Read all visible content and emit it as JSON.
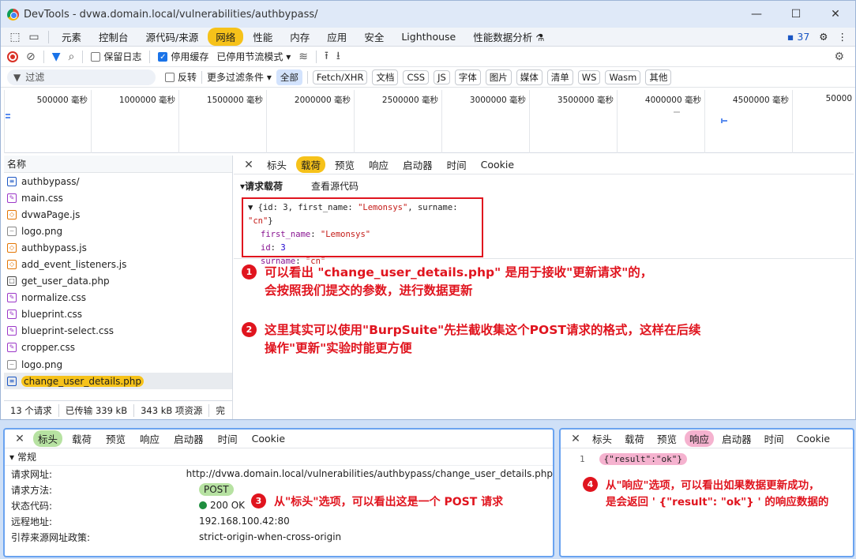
{
  "window": {
    "title": "DevTools - dvwa.domain.local/vulnerabilities/authbypass/",
    "controls": [
      "—",
      "☐",
      "✕"
    ]
  },
  "main_tabs": {
    "items": [
      "元素",
      "控制台",
      "源代码/来源",
      "网络",
      "性能",
      "内存",
      "应用",
      "安全",
      "Lighthouse",
      "性能数据分析 ⚗"
    ],
    "active": "网络",
    "message_count": "37"
  },
  "toolbar": {
    "preserve_log": "保留日志",
    "disable_cache": "停用缓存",
    "throttling": "已停用节流模式"
  },
  "filterbar": {
    "filter_placeholder": "过滤",
    "invert": "反转",
    "more_filters": "更多过滤条件 ▾",
    "types": [
      "全部",
      "Fetch/XHR",
      "文档",
      "CSS",
      "JS",
      "字体",
      "图片",
      "媒体",
      "清单",
      "WS",
      "Wasm",
      "其他"
    ],
    "active_type": "全部"
  },
  "timeline": {
    "ticks": [
      "500000 毫秒",
      "1000000 毫秒",
      "1500000 毫秒",
      "2000000 毫秒",
      "2500000 毫秒",
      "3000000 毫秒",
      "3500000 毫秒",
      "4000000 毫秒",
      "4500000 毫秒",
      "50000"
    ]
  },
  "request_list": {
    "header": "名称",
    "items": [
      {
        "name": "authbypass/",
        "type": "doc"
      },
      {
        "name": "main.css",
        "type": "css"
      },
      {
        "name": "dvwaPage.js",
        "type": "js"
      },
      {
        "name": "logo.png",
        "type": "img"
      },
      {
        "name": "authbypass.js",
        "type": "js"
      },
      {
        "name": "add_event_listeners.js",
        "type": "js"
      },
      {
        "name": "get_user_data.php",
        "type": "php"
      },
      {
        "name": "normalize.css",
        "type": "css"
      },
      {
        "name": "blueprint.css",
        "type": "css"
      },
      {
        "name": "blueprint-select.css",
        "type": "css"
      },
      {
        "name": "cropper.css",
        "type": "css"
      },
      {
        "name": "logo.png",
        "type": "img"
      },
      {
        "name": "change_user_details.php",
        "type": "doc"
      }
    ],
    "selected_index": 12,
    "status": [
      "13 个请求",
      "已传输 339 kB",
      "343 kB 项资源",
      "完"
    ]
  },
  "detail": {
    "tabs": [
      "标头",
      "载荷",
      "预览",
      "响应",
      "启动器",
      "时间",
      "Cookie"
    ],
    "active": "载荷",
    "payload_title": "▾请求载荷",
    "view_source": "查看源代码",
    "payload_summary_open": "▼ {id: 3, first_name: ",
    "payload_summary_fn": "\"Lemonsys\"",
    "payload_summary_mid": ", surname: ",
    "payload_summary_sn": "\"cn\"",
    "payload_summary_close": "}",
    "fields": [
      {
        "key": "first_name",
        "value": "\"Lemonsys\"",
        "kind": "string"
      },
      {
        "key": "id",
        "value": "3",
        "kind": "number"
      },
      {
        "key": "surname",
        "value": "\"cn\"",
        "kind": "string"
      }
    ]
  },
  "annotations": {
    "n1": {
      "num": "1",
      "line1": "可以看出 \"change_user_details.php\" 是用于接收\"更新请求\"的，",
      "line2": "会按照我们提交的参数，进行数据更新"
    },
    "n2": {
      "num": "2",
      "line1": "这里其实可以使用\"BurpSuite\"先拦截收集这个POST请求的格式，这样在后续",
      "line2": "操作\"更新\"实验时能更方便"
    },
    "n3": {
      "num": "3",
      "line1": "从\"标头\"选项，可以看出这是一个 POST 请求"
    },
    "n4": {
      "num": "4",
      "line1": "从\"响应\"选项，可以看出如果数据更新成功，",
      "line2": "是会返回 ' {\"result\": \"ok\"} ' 的响应数据的"
    }
  },
  "headers_panel": {
    "tabs": [
      "标头",
      "载荷",
      "预览",
      "响应",
      "启动器",
      "时间",
      "Cookie"
    ],
    "active": "标头",
    "section": "常规",
    "rows": [
      {
        "label": "请求网址:",
        "value": "http://dvwa.domain.local/vulnerabilities/authbypass/change_user_details.php"
      },
      {
        "label": "请求方法:",
        "value": "POST"
      },
      {
        "label": "状态代码:",
        "value": "200 OK"
      },
      {
        "label": "远程地址:",
        "value": "192.168.100.42:80"
      },
      {
        "label": "引荐来源网址政策:",
        "value": "strict-origin-when-cross-origin"
      }
    ]
  },
  "response_panel": {
    "tabs": [
      "标头",
      "载荷",
      "预览",
      "响应",
      "启动器",
      "时间",
      "Cookie"
    ],
    "active": "响应",
    "line_no": "1",
    "body": "{\"result\":\"ok\"}"
  },
  "colors": {
    "accent_yellow": "#f6c21a",
    "annotation_red": "#e0141e",
    "panel_border": "#6aa3f0"
  }
}
